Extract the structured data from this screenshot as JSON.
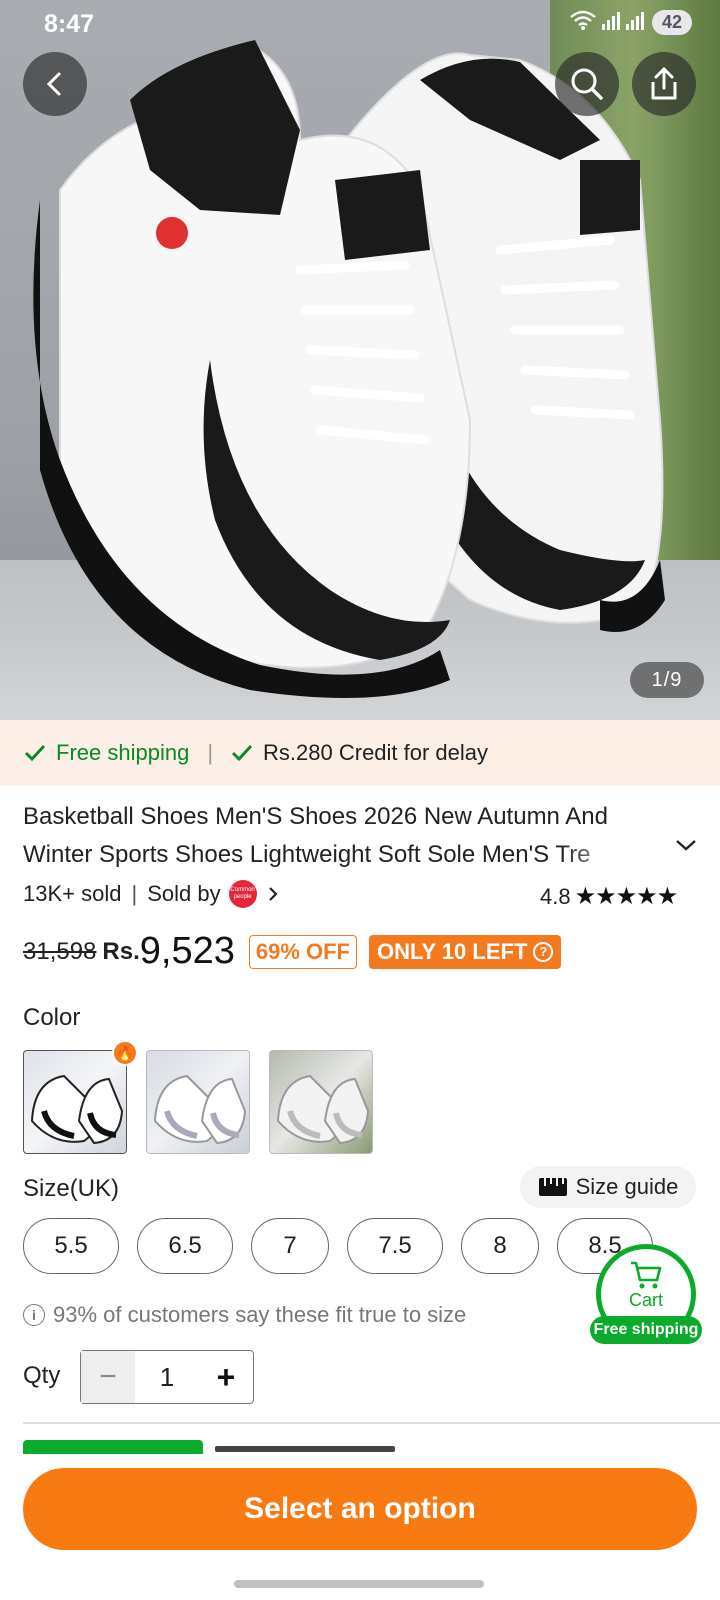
{
  "status": {
    "time": "8:47",
    "battery": "42"
  },
  "gallery": {
    "counter": "1/9"
  },
  "shipping": {
    "free_label": "Free shipping",
    "credit_label": "Rs.280 Credit for delay"
  },
  "product": {
    "title": "Basketball Shoes Men'S Shoes 2026 New Autumn And Winter Sports Shoes Lightweight Soft Sole Men'S Tre",
    "sold": "13K+ sold",
    "sold_by": "Sold by",
    "seller_logo_text": "Common people",
    "rating": "4.8",
    "stars": "★★★★★",
    "old_price": "31,598",
    "currency": "Rs.",
    "price": "9,523",
    "discount": "69% OFF",
    "stock": "ONLY 10 LEFT"
  },
  "color": {
    "label": "Color"
  },
  "size": {
    "label": "Size(UK)",
    "guide": "Size guide",
    "options": [
      "5.5",
      "6.5",
      "7",
      "7.5",
      "8",
      "8.5"
    ],
    "fit_note": "93% of customers say these fit true to size"
  },
  "cart": {
    "label": "Cart",
    "badge": "Free shipping"
  },
  "qty": {
    "label": "Qty",
    "value": "1"
  },
  "cta": {
    "label": "Select an option"
  },
  "colors": {
    "accent": "#f97a10",
    "green": "#0aaa2a",
    "banner": "#fcefe6"
  }
}
